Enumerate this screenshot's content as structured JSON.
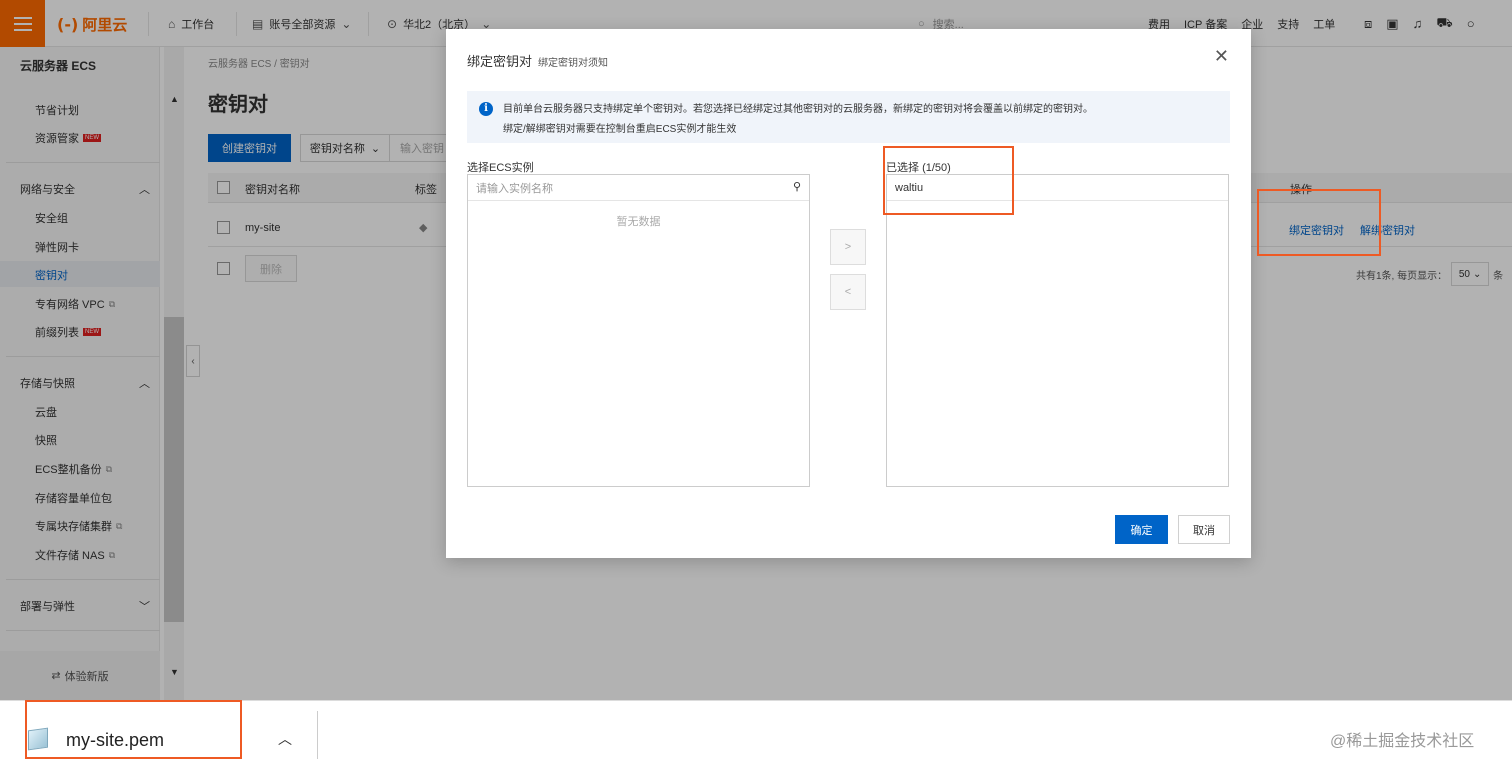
{
  "topbar": {
    "logo_text": "阿里云",
    "workbench": "工作台",
    "account_scope": "账号全部资源",
    "region": "华北2（北京）",
    "search_placeholder": "搜索...",
    "links": [
      "费用",
      "ICP 备案",
      "企业",
      "支持",
      "工单"
    ]
  },
  "sidebar": {
    "title": "云服务器 ECS",
    "items_top": [
      {
        "label": "节省计划"
      },
      {
        "label": "资源管家",
        "badge": "NEW"
      }
    ],
    "group_network": "网络与安全",
    "network_items": [
      {
        "label": "安全组"
      },
      {
        "label": "弹性网卡"
      },
      {
        "label": "密钥对"
      },
      {
        "label": "专有网络 VPC"
      },
      {
        "label": "前缀列表",
        "badge": "NEW"
      }
    ],
    "group_storage": "存储与快照",
    "storage_items": [
      {
        "label": "云盘"
      },
      {
        "label": "快照"
      },
      {
        "label": "ECS整机备份"
      },
      {
        "label": "存储容量单位包"
      },
      {
        "label": "专属块存储集群"
      },
      {
        "label": "文件存储 NAS"
      }
    ],
    "group_deploy": "部署与弹性",
    "bottom": "体验新版"
  },
  "main": {
    "breadcrumb": [
      "云服务器 ECS",
      "密钥对"
    ],
    "title": "密钥对",
    "create_button": "创建密钥对",
    "filter_select": "密钥对名称",
    "filter_placeholder": "输入密钥",
    "columns": [
      "密钥对名称",
      "标签",
      "操作"
    ],
    "rows": [
      {
        "name": "my-site",
        "actions": [
          "绑定密钥对",
          "解绑密钥对"
        ]
      }
    ],
    "delete_button": "删除",
    "pager_text": "共有1条, 每页显示：",
    "page_size": "50",
    "pager_suffix": "条"
  },
  "modal": {
    "title": "绑定密钥对",
    "subtitle": "绑定密钥对须知",
    "notice_line1": "目前单台云服务器只支持绑定单个密钥对。若您选择已经绑定过其他密钥对的云服务器，新绑定的密钥对将会覆盖以前绑定的密钥对。",
    "notice_line2": "绑定/解绑密钥对需要在控制台重启ECS实例才能生效",
    "left_label": "选择ECS实例",
    "left_placeholder": "请输入实例名称",
    "left_empty": "暂无数据",
    "right_label": "已选择",
    "right_count": "(1/50)",
    "right_selected": "waltiu",
    "move_right": ">",
    "move_left": "<",
    "confirm": "确定",
    "cancel": "取消"
  },
  "download_bar": {
    "file_name": "my-site.pem"
  },
  "watermark": "@稀土掘金技术社区",
  "colors": {
    "brand": "#ff6a00",
    "primary": "#0064c8",
    "highlight": "#ee5a24"
  }
}
